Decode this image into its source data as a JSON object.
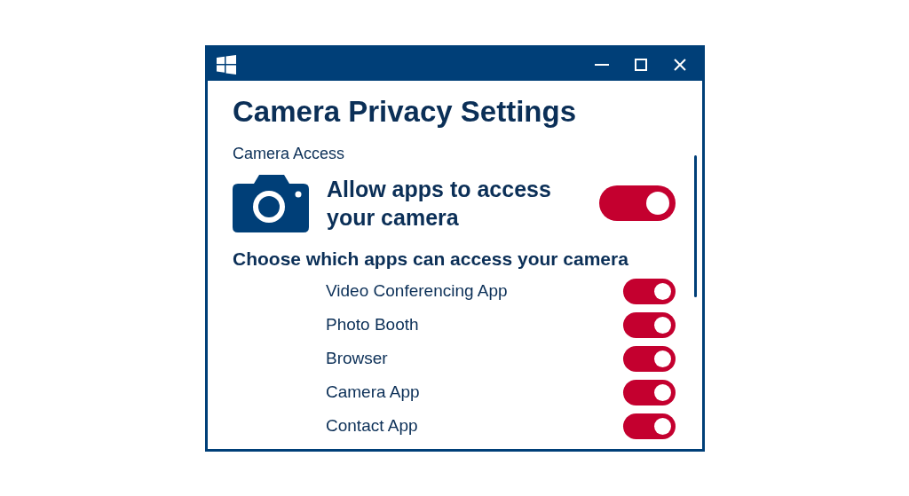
{
  "window": {
    "title": "Camera Privacy Settings"
  },
  "section": "Camera Access",
  "master": {
    "label": "Allow apps to access your camera",
    "on": true
  },
  "apps_heading": "Choose which apps can access your camera",
  "apps": [
    {
      "name": "Video Conferencing App",
      "on": true
    },
    {
      "name": "Photo Booth",
      "on": true
    },
    {
      "name": "Browser",
      "on": true
    },
    {
      "name": "Camera App",
      "on": true
    },
    {
      "name": "Contact App",
      "on": true
    }
  ]
}
